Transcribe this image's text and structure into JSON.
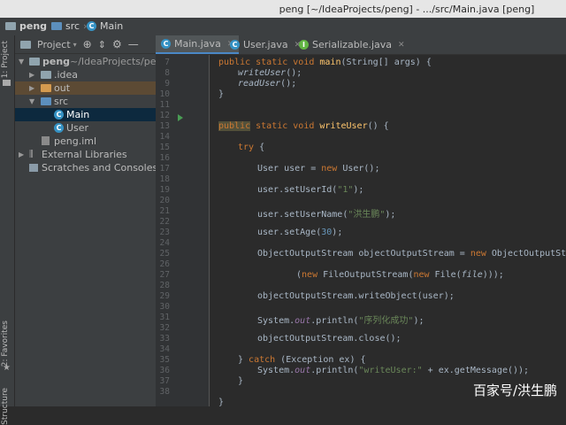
{
  "window": {
    "title": "peng [~/IdeaProjects/peng] - .../src/Main.java [peng]"
  },
  "breadcrumb": {
    "project": "peng",
    "folder": "src",
    "file": "Main"
  },
  "leftstrip": {
    "project_tab": "1: Project",
    "favorites_tab": "2: Favorites",
    "structure_tab": "Structure"
  },
  "project_panel": {
    "view_label": "Project",
    "tree": {
      "root_name": "peng",
      "root_path": "~/IdeaProjects/peng",
      "idea": ".idea",
      "out": "out",
      "src": "src",
      "main": "Main",
      "user": "User",
      "iml": "peng.iml",
      "ext_libs": "External Libraries",
      "scratches": "Scratches and Consoles"
    }
  },
  "tabs": {
    "main": "Main.java",
    "user": "User.java",
    "serializable": "Serializable.java"
  },
  "editor": {
    "line_numbers": [
      "7",
      "8",
      "9",
      "10",
      "11",
      "12",
      "13",
      "14",
      "15",
      "16",
      "17",
      "18",
      "19",
      "20",
      "21",
      "22",
      "23",
      "24",
      "25",
      "26",
      "27",
      "28",
      "29",
      "30",
      "31",
      "32",
      "33",
      "34",
      "35",
      "36",
      "37",
      "38"
    ],
    "code": {
      "l7": {
        "kw": "public static void ",
        "fn": "main",
        "rest": "(String[] args) {"
      },
      "l8": {
        "call": "writeUser",
        "rest": "();"
      },
      "l9": {
        "call": "readUser",
        "rest": "();"
      },
      "l10": "}",
      "l13": {
        "kw1": "public",
        "kw2": " static void ",
        "fn": "writeUser",
        "rest": "() {"
      },
      "l15": {
        "kw": "try",
        "rest": " {"
      },
      "l17": {
        "a": "User user = ",
        "kw": "new",
        "b": " User();"
      },
      "l19": {
        "a": "user.setUserId(",
        "str": "\"1\"",
        "b": ");"
      },
      "l21": {
        "a": "user.setUserName(",
        "str": "\"洪生鹏\"",
        "b": ");"
      },
      "l23": {
        "a": "user.setAge(",
        "num": "30",
        "b": ");"
      },
      "l25": {
        "a": "ObjectOutputStream objectOutputStream = ",
        "kw": "new",
        "b": " ObjectOutputStream"
      },
      "l27": {
        "a": "(",
        "kw1": "new",
        "b": " FileOutputStream(",
        "kw2": "new",
        "c": " File(",
        "par": "file",
        "d": ")));"
      },
      "l29": "objectOutputStream.writeObject(user);",
      "l31": {
        "a": "System.",
        "fld": "out",
        "b": ".println(",
        "str": "\"序列化成功\"",
        "c": ");"
      },
      "l33": "objectOutputStream.close();",
      "l35": {
        "a": "} ",
        "kw": "catch",
        "b": " (Exception ex) {"
      },
      "l36": {
        "a": "System.",
        "fld": "out",
        "b": ".println(",
        "str": "\"writeUser:\"",
        "c": " + ex.getMessage());"
      },
      "l37": "}",
      "l38": "}"
    }
  },
  "watermark": "百家号/洪生鹏",
  "colors": {
    "keyword": "#cc7832",
    "function": "#ffc66d",
    "string": "#6a8759",
    "number": "#6897bb",
    "field": "#9876aa"
  }
}
